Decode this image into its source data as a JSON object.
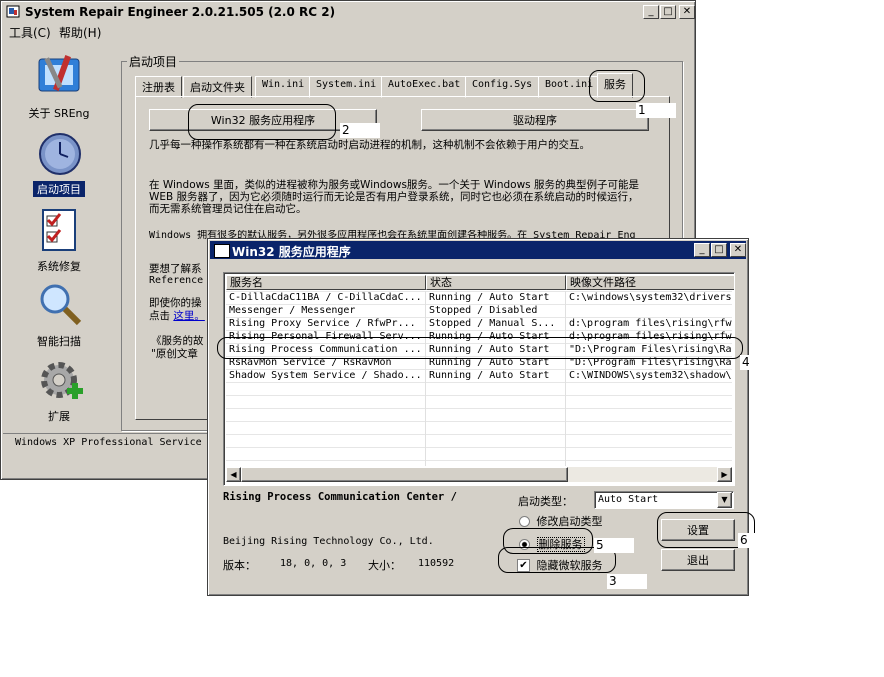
{
  "main_window": {
    "title": "System Repair Engineer 2.0.21.505 (2.0 RC 2)",
    "menu": [
      "工具(C)",
      "帮助(H)"
    ],
    "sidebar": [
      {
        "label": "关于 SREng",
        "icon": "toolbox-icon"
      },
      {
        "label": "启动项目",
        "icon": "clock-icon"
      },
      {
        "label": "系统修复",
        "icon": "checklist-icon"
      },
      {
        "label": "智能扫描",
        "icon": "magnifier-icon"
      },
      {
        "label": "扩展",
        "icon": "gear-plus-icon"
      }
    ],
    "group_title": "启动项目",
    "tabs": [
      "注册表",
      "启动文件夹",
      "Win.ini",
      "System.ini",
      "AutoExec.bat",
      "Config.Sys",
      "Boot.ini",
      "服务"
    ],
    "buttons": {
      "win32": "Win32 服务应用程序",
      "driver": "驱动程序"
    },
    "paragraphs": {
      "p1": "几乎每一种操作系统都有一种在系统启动时启动进程的机制，这种机制不会依赖于用户的交互。",
      "p2": "在 Windows 里面，类似的进程被称为服务或Windows服务。一个关于 Windows 服务的典型例子可能是 WEB 服务器了，因为它必须随时运行而无论是否有用户登录系统，同时它也必须在系统启动的时候运行，而无需系统管理员记住在启动它。",
      "p3": "Windows 拥有很多的默认服务，另外很多应用程序也会在系统里面创建各种服务。在 System Repair Eng",
      "p4a": "要想了解系",
      "p4b": "Reference",
      "p5a": "即使你的操",
      "p5b": "点击",
      "p5_link": "这里。",
      "p6a": "《服务的故",
      "p6b": "\"原创文章"
    },
    "status": "Windows XP Professional Service"
  },
  "service_window": {
    "title": "Win32 服务应用程序",
    "columns": [
      "服务名",
      "状态",
      "映像文件路径"
    ],
    "rows": [
      {
        "name": "C-DillaCdaC11BA / C-DillaCdaC...",
        "status": "Running / Auto Start",
        "path": "C:\\windows\\system32\\drivers"
      },
      {
        "name": "Messenger / Messenger",
        "status": "Stopped / Disabled",
        "path": ""
      },
      {
        "name": "Rising Proxy  Service / RfwPr...",
        "status": "Stopped / Manual S...",
        "path": "d:\\program files\\rising\\rfw"
      },
      {
        "name": "Rising Personal Firewall Serv...",
        "status": "Running / Auto Start",
        "path": "d:\\program files\\rising\\rfw"
      },
      {
        "name": "Rising Process Communication ...",
        "status": "Running / Auto Start",
        "path": "\"D:\\Program Files\\rising\\Ra"
      },
      {
        "name": "RsRavMon Service / RsRavMon",
        "status": "Running / Auto Start",
        "path": "\"D:\\Program Files\\rising\\Ra"
      },
      {
        "name": "Shadow System Service / Shado...",
        "status": "Running / Auto Start",
        "path": "C:\\WINDOWS\\system32\\shadow\\"
      }
    ],
    "selected_name": "Rising Process Communication Center /",
    "startup_type_label": "启动类型：",
    "startup_type_value": "Auto Start",
    "radio_modify": "修改启动类型",
    "radio_delete": "删除服务",
    "checkbox_hide": "隐藏微软服务",
    "company": "Beijing Rising Technology Co., Ltd.",
    "version_label": "版本：",
    "version_value": "18, 0, 0, 3",
    "size_label": "大小：",
    "size_value": "110592",
    "btn_set": "设置",
    "btn_exit": "退出"
  },
  "annotations": [
    "1",
    "2",
    "3",
    "4",
    "5",
    "6"
  ]
}
